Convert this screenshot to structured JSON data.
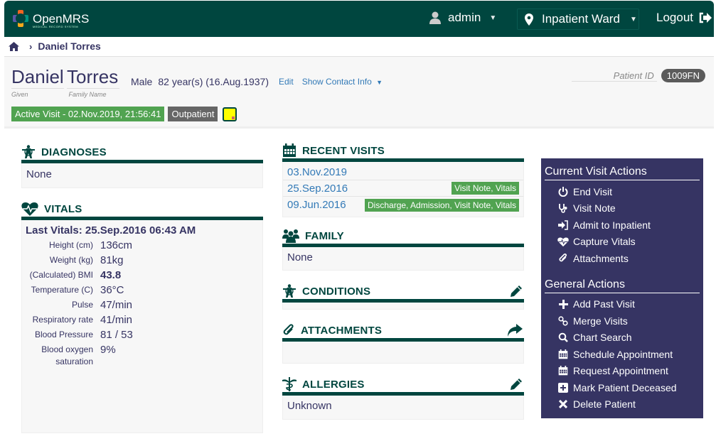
{
  "header": {
    "app_name": "OpenMRS",
    "app_subtitle": "MEDICAL RECORD SYSTEM",
    "user": "admin",
    "location": "Inpatient Ward",
    "logout": "Logout"
  },
  "breadcrumb": {
    "current": "Daniel Torres"
  },
  "patient": {
    "given": "Daniel",
    "family": "Torres",
    "given_label": "Given",
    "family_label": "Family Name",
    "gender": "Male",
    "age": "82 year(s) (16.Aug.1937)",
    "edit": "Edit",
    "show_contact": "Show Contact Info",
    "active_visit": "Active Visit - 02.Nov.2019, 21:56:41",
    "visit_type": "Outpatient",
    "id_label": "Patient ID",
    "id_value": "1009FN"
  },
  "diagnoses": {
    "title": "DIAGNOSES",
    "value": "None"
  },
  "vitals": {
    "title": "VITALS",
    "last": "Last Vitals: 25.Sep.2016 06:43 AM",
    "rows": [
      {
        "label": "Height (cm)",
        "value": "136cm"
      },
      {
        "label": "Weight (kg)",
        "value": "81kg"
      },
      {
        "label": "(Calculated) BMI",
        "value": "43.8"
      },
      {
        "label": "Temperature (C)",
        "value": "36°C"
      },
      {
        "label": "Pulse",
        "value": "47/min"
      },
      {
        "label": "Respiratory rate",
        "value": "41/min"
      },
      {
        "label": "Blood Pressure",
        "value": "81 / 53"
      },
      {
        "label": "Blood oxygen saturation",
        "value": "9%"
      }
    ]
  },
  "recent_visits": {
    "title": "RECENT VISITS",
    "items": [
      {
        "date": "03.Nov.2019",
        "tags": ""
      },
      {
        "date": "25.Sep.2016",
        "tags": "Visit Note, Vitals"
      },
      {
        "date": "09.Jun.2016",
        "tags": "Discharge, Admission, Visit Note, Vitals"
      }
    ]
  },
  "family": {
    "title": "FAMILY",
    "value": "None"
  },
  "conditions": {
    "title": "CONDITIONS"
  },
  "attachments": {
    "title": "ATTACHMENTS"
  },
  "allergies": {
    "title": "ALLERGIES",
    "value": "Unknown"
  },
  "current_actions": {
    "title": "Current Visit Actions",
    "items": [
      "End Visit",
      "Visit Note",
      "Admit to Inpatient",
      "Capture Vitals",
      "Attachments"
    ]
  },
  "general_actions": {
    "title": "General Actions",
    "items": [
      "Add Past Visit",
      "Merge Visits",
      "Chart Search",
      "Schedule Appointment",
      "Request Appointment",
      "Mark Patient Deceased",
      "Delete Patient"
    ]
  },
  "colors": {
    "brand": "#00463f",
    "accent": "#363463",
    "success": "#51a351",
    "link": "#337ab7"
  }
}
